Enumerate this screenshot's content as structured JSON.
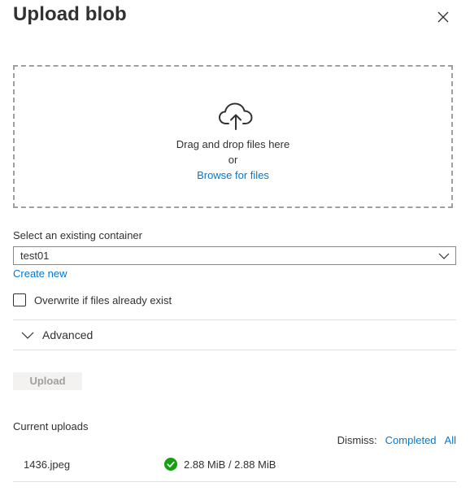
{
  "panel": {
    "title": "Upload blob",
    "close_icon": "close-icon"
  },
  "dropzone": {
    "icon": "cloud-upload-icon",
    "main_text": "Drag and drop files here",
    "or_text": "or",
    "browse_label": "Browse for files"
  },
  "container": {
    "label": "Select an existing container",
    "selected_value": "test01",
    "chevron_icon": "chevron-down-icon",
    "create_new_label": "Create new"
  },
  "overwrite": {
    "label": "Overwrite if files already exist",
    "checked": false
  },
  "advanced": {
    "label": "Advanced",
    "chevron_icon": "chevron-down-icon"
  },
  "upload_button": {
    "label": "Upload",
    "enabled": false
  },
  "current_uploads": {
    "heading": "Current uploads",
    "dismiss_label": "Dismiss:",
    "dismiss_completed": "Completed",
    "dismiss_all": "All",
    "items": [
      {
        "file_name": "1436.jpeg",
        "status_icon": "success-check-icon",
        "size_progress": "2.88 MiB / 2.88 MiB"
      }
    ]
  },
  "colors": {
    "accent": "#0078d4",
    "success": "#13a10e",
    "text": "#323130",
    "disabled_text": "#a19f9d",
    "disabled_bg": "#f3f2f1",
    "border": "#8a8886",
    "dash_border": "#a19f9d"
  }
}
